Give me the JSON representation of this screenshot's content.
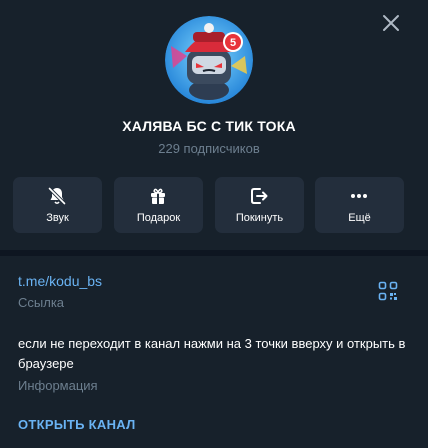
{
  "channel": {
    "title": "ХАЛЯВА БС С ТИК ТОКА",
    "subscribers": "229 подписчиков"
  },
  "actions": [
    {
      "label": "Звук",
      "icon": "bell-muted-icon"
    },
    {
      "label": "Подарок",
      "icon": "gift-icon"
    },
    {
      "label": "Покинуть",
      "icon": "leave-icon"
    },
    {
      "label": "Ещё",
      "icon": "more-dots-icon"
    }
  ],
  "info": {
    "link": "t.me/kodu_bs",
    "link_caption": "Ссылка",
    "description": "если не переходит в канал нажми на 3 точки вверху и открыть в браузере",
    "description_caption": "Информация",
    "open_button": "ОТКРЫТЬ КАНАЛ"
  },
  "avatar_badge": "5",
  "colors": {
    "background": "#17212b",
    "button_bg": "#232e3c",
    "accent": "#6ab3f3",
    "muted": "#6d7f8f",
    "separator": "#0e1621"
  }
}
